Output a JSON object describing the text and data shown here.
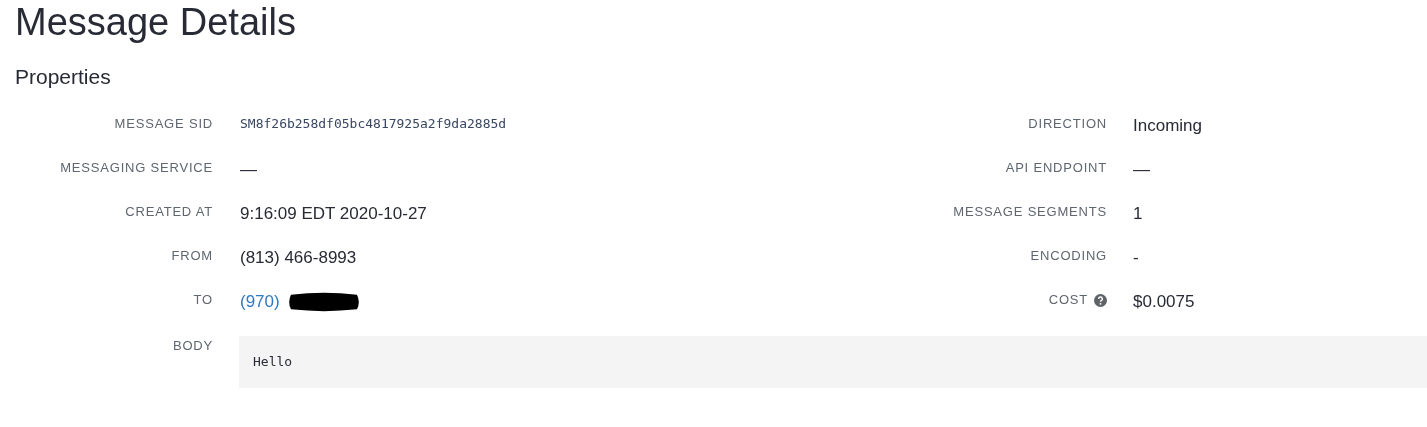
{
  "title": "Message Details",
  "section": "Properties",
  "left_fields": [
    {
      "label": "MESSAGE SID",
      "value": "SM8f26b258df05bc4817925a2f9da2885d",
      "kind": "mono",
      "redacted": false
    },
    {
      "label": "MESSAGING SERVICE",
      "value": "—",
      "kind": "text",
      "redacted": false
    },
    {
      "label": "CREATED AT",
      "value": "9:16:09 EDT 2020-10-27",
      "kind": "text",
      "redacted": false
    },
    {
      "label": "FROM",
      "value": "(813) 466-8993",
      "kind": "text",
      "redacted": false
    },
    {
      "label": "TO",
      "value": "(970)",
      "kind": "link",
      "redacted": true
    }
  ],
  "right_fields": [
    {
      "label": "DIRECTION",
      "value": "Incoming",
      "help": false
    },
    {
      "label": "API ENDPOINT",
      "value": "—",
      "help": false
    },
    {
      "label": "MESSAGE SEGMENTS",
      "value": "1",
      "help": false
    },
    {
      "label": "ENCODING",
      "value": "-",
      "help": false
    },
    {
      "label": "COST",
      "value": "$0.0075",
      "help": true
    }
  ],
  "body": {
    "label": "BODY",
    "value": "Hello"
  }
}
